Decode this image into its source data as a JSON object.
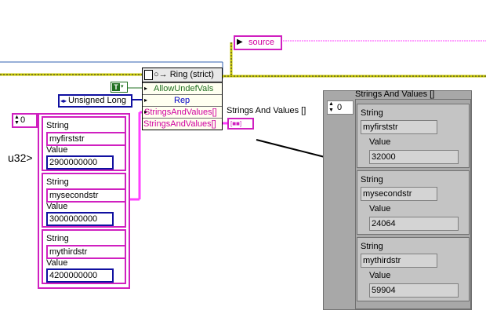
{
  "source_label": "source",
  "property_node": {
    "title": "Ring (strict)",
    "properties": [
      "AllowUndefVals",
      "Rep",
      "StringsAndValues[]",
      "StringsAndValues[]"
    ]
  },
  "true_constant": "T",
  "rep_constant": "Unsigned Long",
  "u32_label": "u32>",
  "array_index": "0",
  "clusters": [
    {
      "string_label": "String",
      "string_value": "myfirststr",
      "value_label": "Value",
      "value": "2900000000"
    },
    {
      "string_label": "String",
      "string_value": "mysecondstr",
      "value_label": "Value",
      "value": "3000000000"
    },
    {
      "string_label": "String",
      "string_value": "mythirdstr",
      "value_label": "Value",
      "value": "4200000000"
    }
  ],
  "indicator_label": "Strings And Values []",
  "panel": {
    "title": "Strings And Values []",
    "index": "0",
    "clusters": [
      {
        "string_label": "String",
        "string_value": "myfirststr",
        "value_label": "Value",
        "value": "32000"
      },
      {
        "string_label": "String",
        "string_value": "mysecondstr",
        "value_label": "Value",
        "value": "24064"
      },
      {
        "string_label": "String",
        "string_value": "mythirdstr",
        "value_label": "Value",
        "value": "59904"
      }
    ]
  },
  "colors": {
    "string_wire": "#ff40ff",
    "refnum_wire": "#000000",
    "error_wire": "#c8c800",
    "numeric_u32": "#1010a0",
    "boolean": "#207020"
  }
}
